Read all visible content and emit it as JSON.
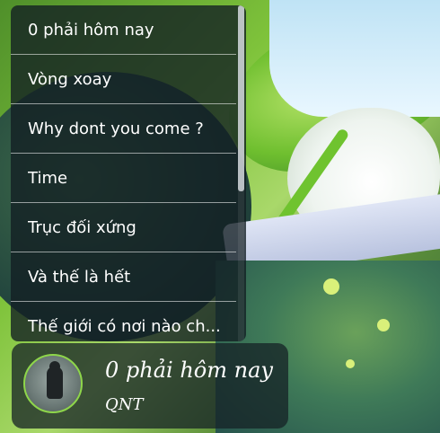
{
  "playlist": {
    "items": [
      {
        "label": "0 phải hôm nay"
      },
      {
        "label": "Vòng xoay"
      },
      {
        "label": "Why dont you come ?"
      },
      {
        "label": "Time"
      },
      {
        "label": "Trục đối xứng"
      },
      {
        "label": "Và thế là hết"
      },
      {
        "label": "Thế giới có nơi nào ch..."
      }
    ]
  },
  "now_playing": {
    "title": "0 phải hôm nay",
    "artist": "QNT",
    "avatar_icon": "album-art-avatar"
  },
  "colors": {
    "panel_bg": "#121e22",
    "accent_ring": "#8ed64a",
    "text": "#ffffff"
  }
}
